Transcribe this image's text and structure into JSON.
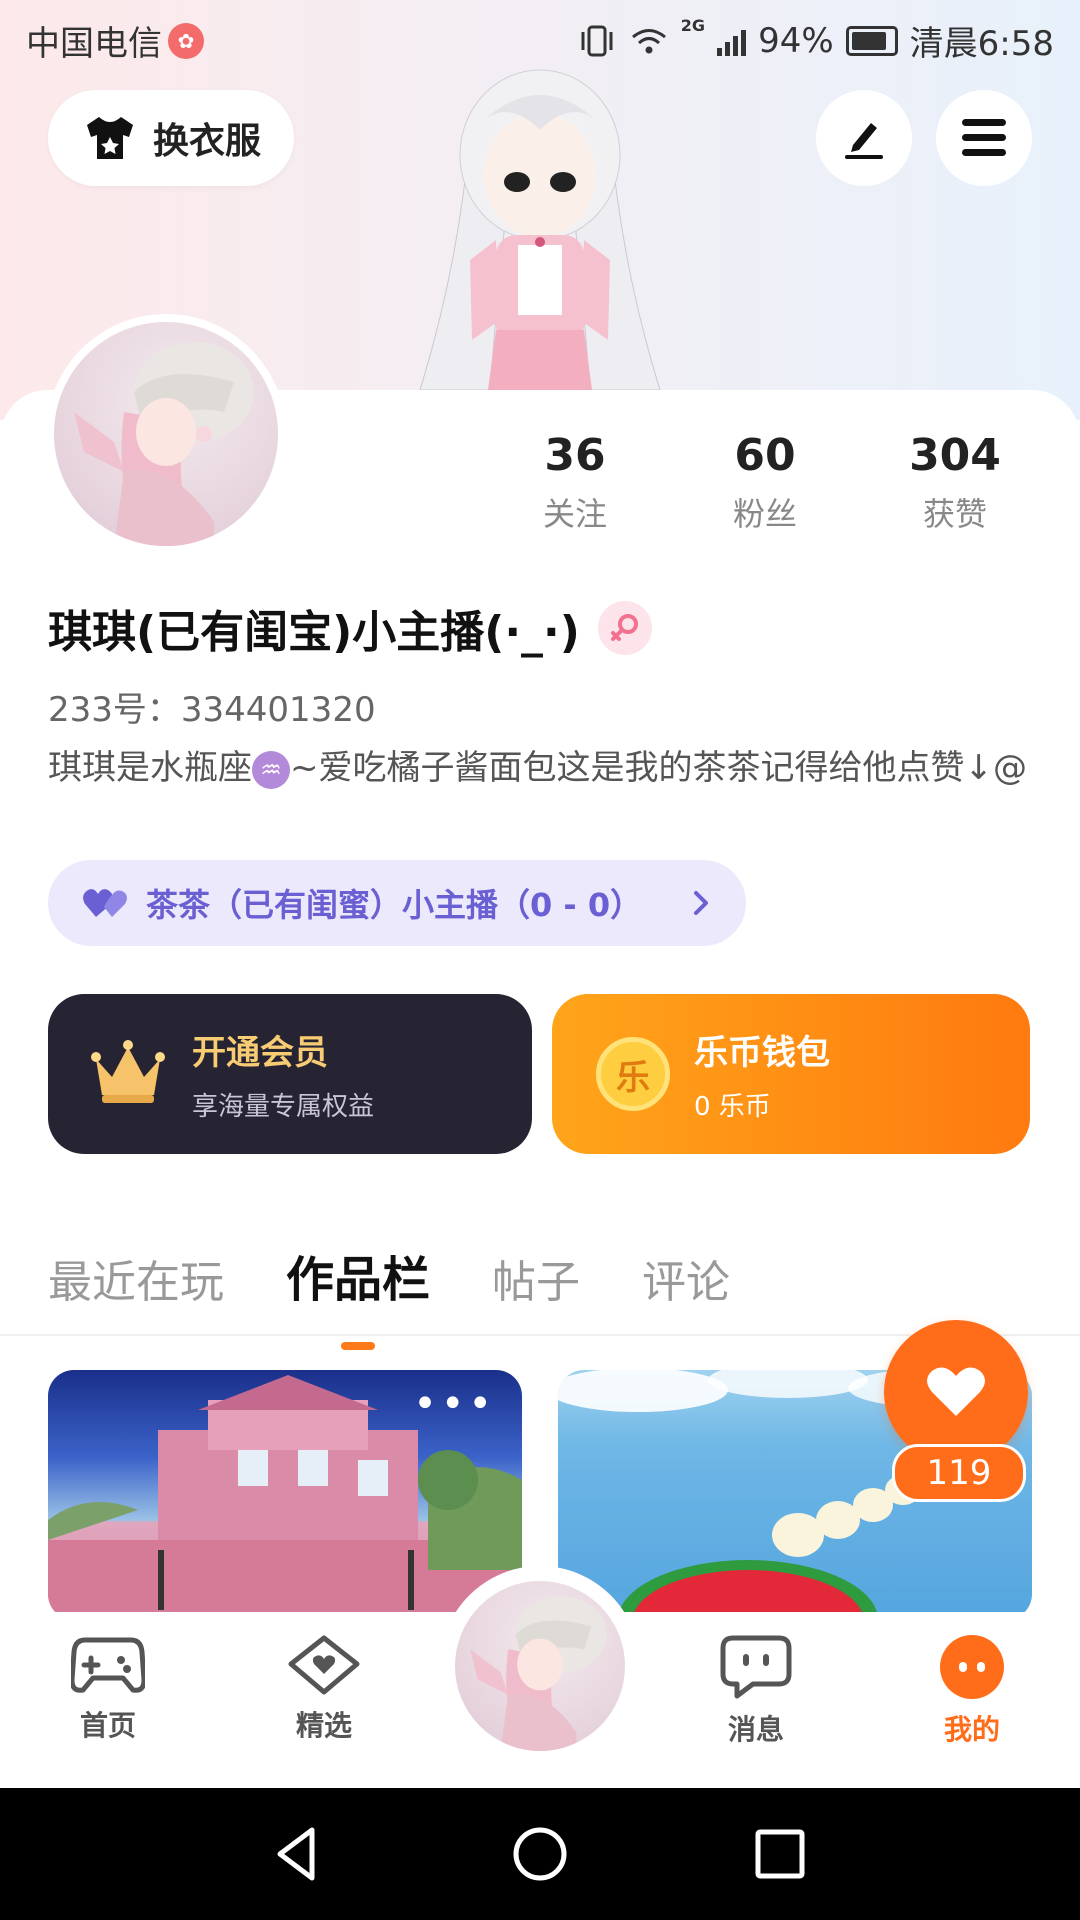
{
  "status_bar": {
    "carrier": "中国电信",
    "battery_pct": "94%",
    "time": "清晨6:58",
    "network": "2G"
  },
  "header": {
    "dress_button_label": "换衣服",
    "icons": [
      "shirt-icon",
      "pencil-icon",
      "menu-icon"
    ]
  },
  "profile": {
    "stats": [
      {
        "value": "36",
        "label": "关注"
      },
      {
        "value": "60",
        "label": "粉丝"
      },
      {
        "value": "304",
        "label": "获赞"
      }
    ],
    "name": "琪琪(已有闺宝)小主播(·_·)",
    "id_line": "233号：334401320",
    "bio_part1": "琪琪是水瓶座",
    "bio_zodiac": "♒",
    "bio_part2": "~爱吃橘子酱面包这是我的茶茶记得给他点赞↓@",
    "relation_label": "茶茶（已有闺蜜）小主播（0 - 0）"
  },
  "cards": {
    "vip": {
      "title": "开通会员",
      "subtitle": "享海量专属权益"
    },
    "wallet": {
      "title": "乐币钱包",
      "subtitle": "0 乐币",
      "coin_text": "乐"
    }
  },
  "tabs": [
    {
      "label": "最近在玩",
      "active": false
    },
    {
      "label": "作品栏",
      "active": true
    },
    {
      "label": "帖子",
      "active": false
    },
    {
      "label": "评论",
      "active": false
    }
  ],
  "works": {
    "more_label": "•••",
    "like_count": "119"
  },
  "bottom_nav": [
    {
      "label": "首页",
      "icon": "gamepad-icon",
      "active": false
    },
    {
      "label": "精选",
      "icon": "heart-diamond-icon",
      "active": false
    },
    {
      "label": "消息",
      "icon": "chat-icon",
      "active": false
    },
    {
      "label": "我的",
      "icon": "me-icon",
      "active": true
    }
  ],
  "colors": {
    "accent": "#ff6d1a",
    "vip_bg": "#262333",
    "relation_text": "#6a5fd3"
  }
}
